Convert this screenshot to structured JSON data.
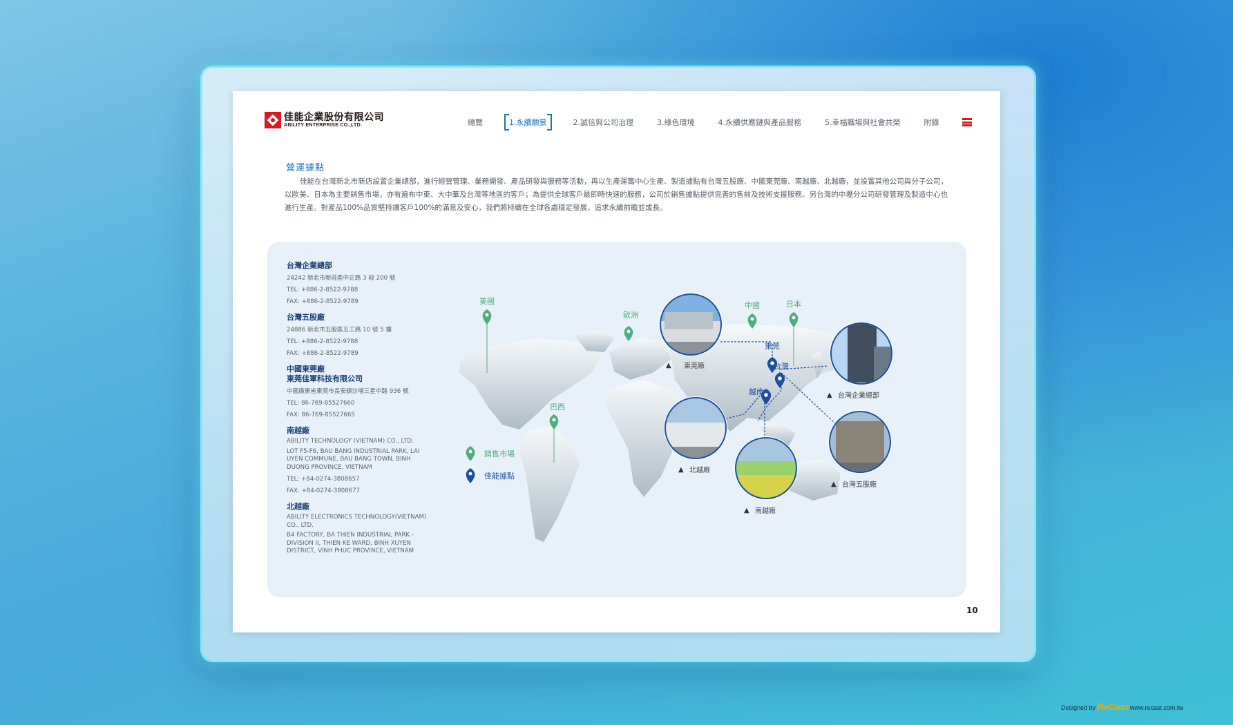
{
  "logo": {
    "cn": "佳能企業股份有限公司",
    "en": "ABILITY ENTERPRISE CO.,LTD."
  },
  "nav": [
    "總覽",
    "1.永續願景",
    "2.誠信與公司治理",
    "3.綠色環境",
    "4.永續供應鏈與產品服務",
    "5.幸福職場與社會共榮",
    "附錄"
  ],
  "nav_active_index": 1,
  "section_title": "營運據點",
  "intro": "佳能在台灣新北市新店設置企業總部，進行經營管理、業務開發、產品研發與服務等活動，再以生產運籌中心生產、製造據點有台灣五股廠、中國東莞廠、南越廠、北越廠，並設置其他公司與分子公司，以歐美、日本為主要銷售市場，亦有遍布中東、大中華及台灣等地區的客戶；為提供全球客戶最即時快速的服務，公司於銷售據點提供完善的售前及技術支援服務。另台灣的中壢分公司研發管理及製造中心也進行生產。對產品100%品質堅持讓客戶100%的滿意及安心，我們將持續在全球各處穩定發展，追求永續前瞻並成長。",
  "locations": [
    {
      "name": "台灣企業總部",
      "lines": [
        "24242 新北市新莊區中正路 3 段 200 號",
        "TEL: +886-2-8522-9788",
        "FAX: +886-2-8522-9789"
      ]
    },
    {
      "name": "台灣五股廠",
      "lines": [
        "24886 新北市五股區五工路 10 號 5 樓",
        "TEL: +886-2-8522-9788",
        "FAX: +886-2-8522-9789"
      ]
    },
    {
      "name": "中國東莞廠\n東莞佳軍科技有限公司",
      "lines": [
        "中國廣東省東莞市長安鎮沙埔三星中路 936 號",
        "TEL: 86-769-85527660",
        "FAX: 86-769-85527665"
      ]
    },
    {
      "name": "南越廠",
      "lines": [
        "ABILITY TECHNOLOGY (VIETNAM) CO., LTD.",
        "LOT F5-F6, BAU BANG INDUSTRIAL PARK, LAI UYEN COMMUNE, BAU BANG TOWN, BINH DUONG PROVINCE, VIETNAM",
        "TEL: +84-0274-3808657",
        "FAX: +84-0274-3808677"
      ]
    },
    {
      "name": "北越廠",
      "lines": [
        "ABILITY ELECTRONICS TECHNOLOGY(VIETNAM) CO., LTD.",
        "B4 FACTORY, BA THIEN INDUSTRIAL PARK - DIVISION II, THIEN KE WARD, BINH XUYEN DISTRICT, VINH PHUC PROVINCE, VIETNAM"
      ]
    }
  ],
  "map": {
    "green_pins": [
      "美國",
      "歐洲",
      "中國",
      "日本",
      "巴西"
    ],
    "blue_pins": [
      "東莞",
      "台灣",
      "越南"
    ],
    "photos": [
      "東莞廠",
      "台灣企業總部",
      "北越廠",
      "南越廠",
      "台灣五股廠"
    ],
    "legend": [
      "銷售市場",
      "佳能據點"
    ],
    "colors": {
      "green": "#4caf7d",
      "blue": "#1b4f9c",
      "continent": "#c9d4dc"
    }
  },
  "page_number": "10",
  "credit": {
    "prefix": "Designed by",
    "brand": "ReCast",
    "url": "www.recast.com.tw"
  }
}
